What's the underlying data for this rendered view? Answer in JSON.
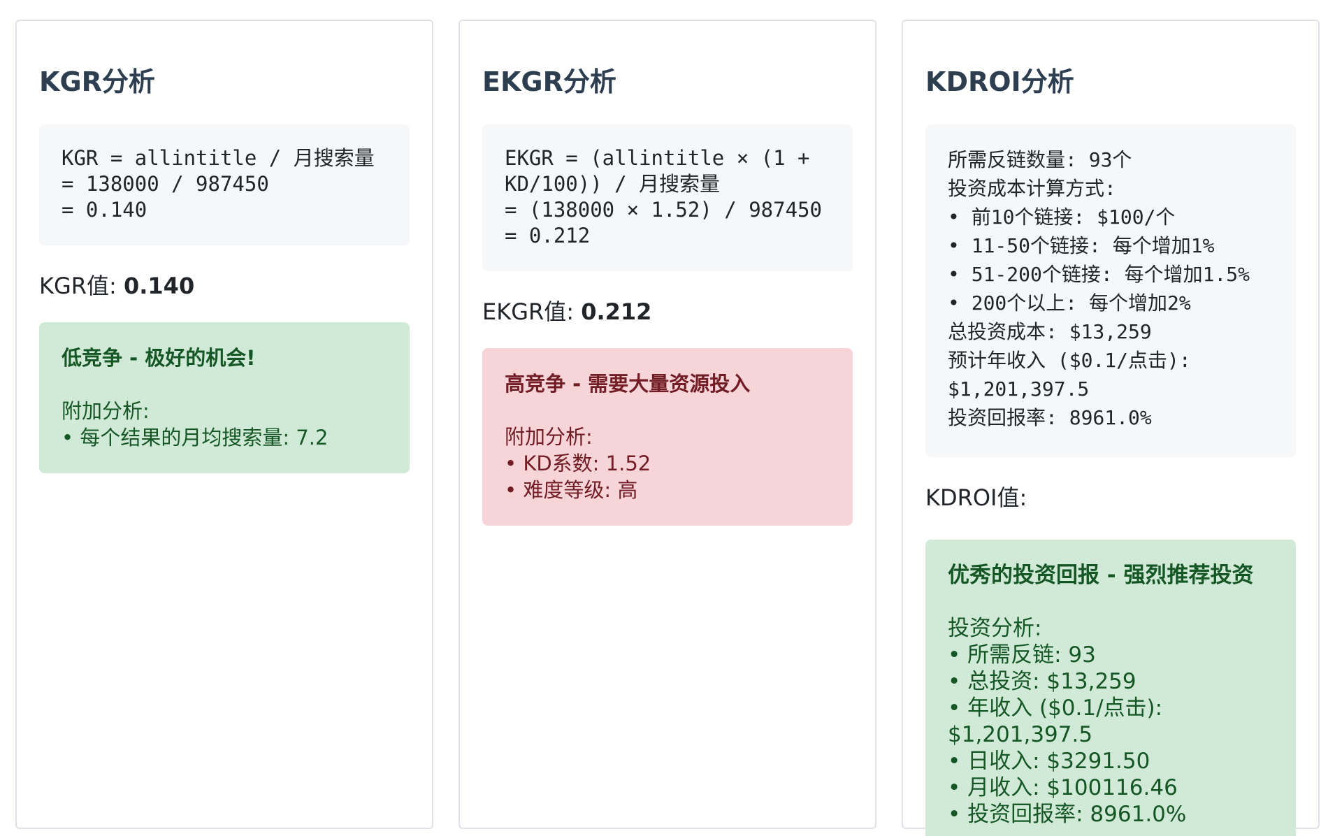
{
  "kgr": {
    "title": "KGR分析",
    "formula": [
      "KGR = allintitle / 月搜索量",
      "= 138000 / 987450",
      "= 0.140"
    ],
    "value_label": "KGR值: ",
    "value": "0.140",
    "result": {
      "headline": "低竞争 - 极好的机会!",
      "sub_heading": "附加分析:",
      "items": [
        "• 每个结果的月均搜索量: 7.2"
      ]
    }
  },
  "ekgr": {
    "title": "EKGR分析",
    "formula": [
      "EKGR = (allintitle × (1 +",
      "KD/100)) / 月搜索量",
      "= (138000 × 1.52) / 987450",
      "= 0.212"
    ],
    "value_label": "EKGR值: ",
    "value": "0.212",
    "result": {
      "headline": "高竞争 - 需要大量资源投入",
      "sub_heading": "附加分析:",
      "items": [
        "• KD系数: 1.52",
        "• 难度等级: 高"
      ]
    }
  },
  "kdroi": {
    "title": "KDROI分析",
    "details": [
      "所需反链数量: 93个",
      "投资成本计算方式:",
      "• 前10个链接: $100/个",
      "• 11-50个链接: 每个增加1%",
      "• 51-200个链接: 每个增加1.5%",
      "• 200个以上: 每个增加2%",
      "总投资成本: $13,259",
      "预计年收入 ($0.1/点击):",
      "$1,201,397.5",
      "投资回报率: 8961.0%"
    ],
    "value_label": "KDROI值:",
    "result": {
      "headline": "优秀的投资回报 - 强烈推荐投资",
      "sub_heading": "投资分析:",
      "items": [
        "• 所需反链: 93",
        "• 总投资: $13,259",
        "• 年收入 ($0.1/点击):",
        "$1,201,397.5",
        "• 日收入: $3291.50",
        "• 月收入: $100116.46",
        "• 投资回报率: 8961.0%"
      ]
    }
  },
  "colors": {
    "title": "#2c3e50",
    "code_bg": "#f6f7f9",
    "green_bg": "#d1ead8",
    "green_text": "#155724",
    "red_bg": "#f6d4d8",
    "red_text": "#721c24",
    "card_border": "#dee2e6"
  }
}
